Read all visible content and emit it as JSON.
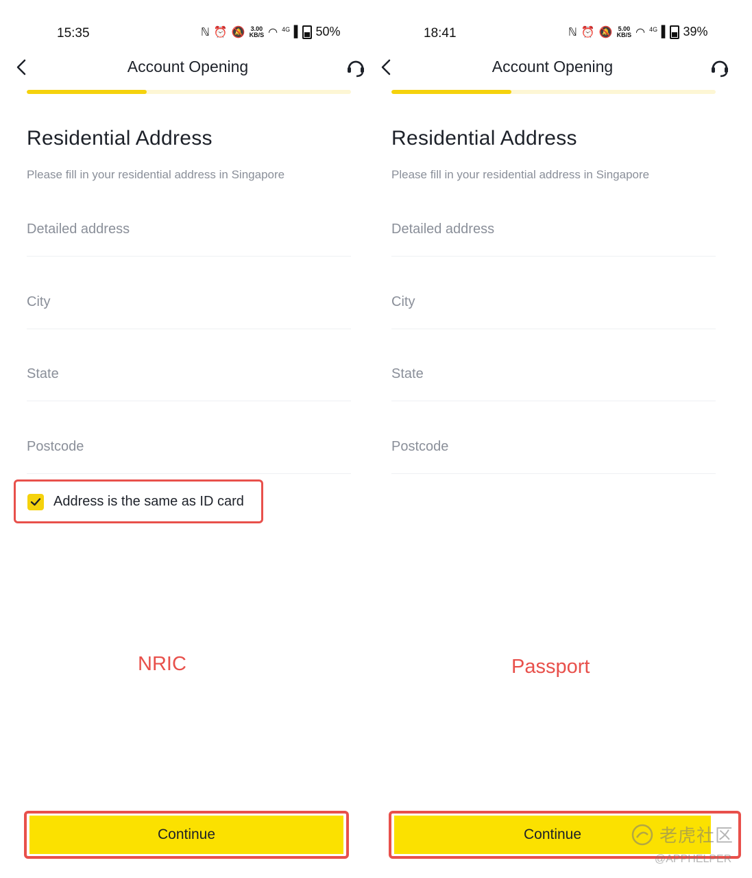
{
  "left": {
    "status": {
      "time": "15:35",
      "net_speed_value": "3.00",
      "net_speed_unit": "KB/S",
      "network": "4G",
      "battery": "50%"
    },
    "nav": {
      "title": "Account Opening"
    },
    "progress": 0.37,
    "heading": "Residential Address",
    "subheading": "Please fill in your residential address in Singapore",
    "fields": {
      "detailed_address": {
        "value": "",
        "placeholder": "Detailed address"
      },
      "city": {
        "value": "",
        "placeholder": "City"
      },
      "state": {
        "value": "",
        "placeholder": "State"
      },
      "postcode": {
        "value": "",
        "placeholder": "Postcode"
      }
    },
    "same_as_id": {
      "label": "Address is the same as ID card",
      "checked": true
    },
    "caption": "NRIC",
    "continue_label": "Continue"
  },
  "right": {
    "status": {
      "time": "18:41",
      "net_speed_value": "5.00",
      "net_speed_unit": "KB/S",
      "network": "4G",
      "battery": "39%"
    },
    "nav": {
      "title": "Account Opening"
    },
    "progress": 0.37,
    "heading": "Residential Address",
    "subheading": "Please fill in your residential address in Singapore",
    "fields": {
      "detailed_address": {
        "value": "",
        "placeholder": "Detailed address"
      },
      "city": {
        "value": "",
        "placeholder": "City"
      },
      "state": {
        "value": "",
        "placeholder": "State"
      },
      "postcode": {
        "value": "",
        "placeholder": "Postcode"
      }
    },
    "caption": "Passport",
    "continue_label": "Continue"
  },
  "watermark": {
    "brand": "老虎社区",
    "handle": "@APPHELPER"
  },
  "colors": {
    "accent_yellow": "#fbe100",
    "progress_track": "#fdf6d4",
    "highlight_red": "#e8504b",
    "placeholder_gray": "#8a8f99"
  },
  "icons": [
    "back-chevron-icon",
    "headset-icon",
    "nfc-icon",
    "alarm-icon",
    "mute-icon",
    "wifi-icon",
    "signal-icon",
    "battery-icon",
    "checkmark-icon",
    "logo-icon"
  ]
}
